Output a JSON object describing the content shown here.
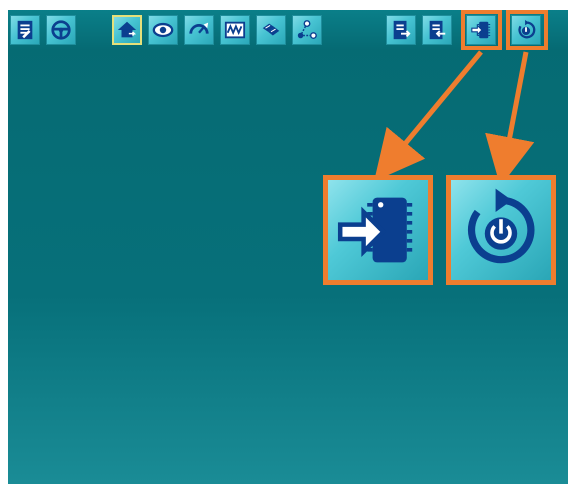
{
  "toolbar": {
    "buttons": [
      {
        "name": "report-icon",
        "active": false
      },
      {
        "name": "steering-wheel-icon",
        "active": false
      },
      {
        "name": "home-icon",
        "active": true
      },
      {
        "name": "eye-icon",
        "active": false
      },
      {
        "name": "gauge-icon",
        "active": false
      },
      {
        "name": "signal-wave-icon",
        "active": false
      },
      {
        "name": "parts-icon",
        "active": false
      },
      {
        "name": "network-nodes-icon",
        "active": false
      },
      {
        "name": "document-export-icon",
        "active": false
      },
      {
        "name": "document-import-icon",
        "active": false
      },
      {
        "name": "chip-input-icon",
        "active": false
      },
      {
        "name": "power-reset-icon",
        "active": false
      }
    ]
  },
  "highlight": {
    "color": "#ef7d2e",
    "callouts": [
      {
        "name": "chip-input-icon"
      },
      {
        "name": "power-reset-icon"
      }
    ]
  },
  "colors": {
    "panel_bg": "#056a72",
    "button_face": "#47c3d2",
    "icon_dark": "#0b3f8f",
    "accent": "#ef7d2e"
  }
}
